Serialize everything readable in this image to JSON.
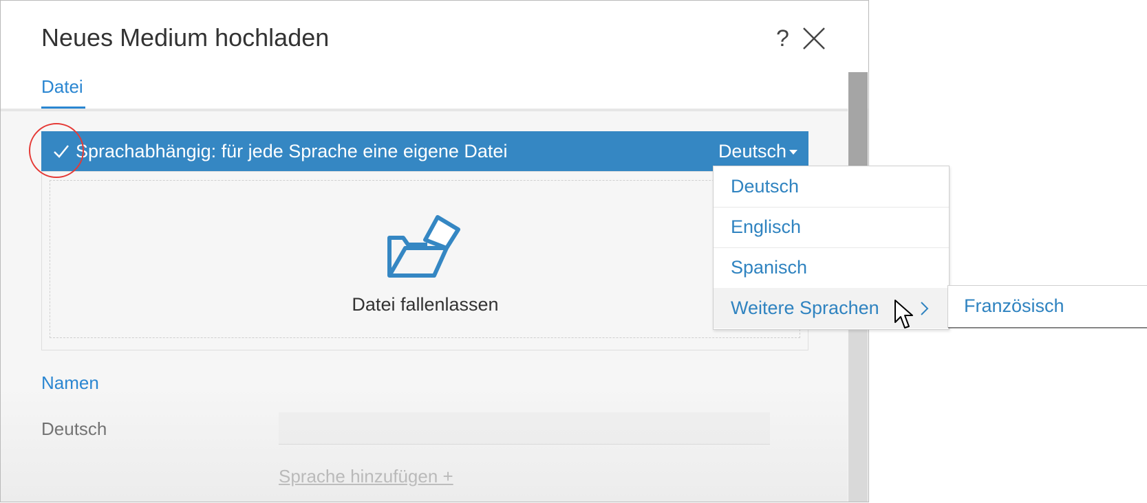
{
  "dialog": {
    "title": "Neues Medium hochladen",
    "help_symbol": "?",
    "tabs": [
      {
        "label": "Datei"
      }
    ]
  },
  "language_bar": {
    "label": "Sprachabhängig: für jede Sprache eine eigene Datei",
    "selected_language": "Deutsch",
    "checked": true
  },
  "dropzone": {
    "label": "Datei fallenlassen"
  },
  "names_section": {
    "heading": "Namen",
    "fields": [
      {
        "label": "Deutsch",
        "value": ""
      }
    ],
    "add_language_label": "Sprache hinzufügen +"
  },
  "language_dropdown": {
    "items": [
      {
        "label": "Deutsch"
      },
      {
        "label": "Englisch"
      },
      {
        "label": "Spanisch"
      },
      {
        "label": "Weitere Sprachen"
      }
    ],
    "submenu": {
      "items": [
        {
          "label": "Französisch"
        }
      ]
    }
  },
  "colors": {
    "accent": "#2a86d1",
    "bar_background": "#3587c3",
    "highlight_circle": "#e53935"
  },
  "icons": [
    "help-icon",
    "close-icon",
    "check-icon",
    "caret-down-icon",
    "folder-upload-icon",
    "chevron-right-icon",
    "mouse-cursor-icon"
  ]
}
